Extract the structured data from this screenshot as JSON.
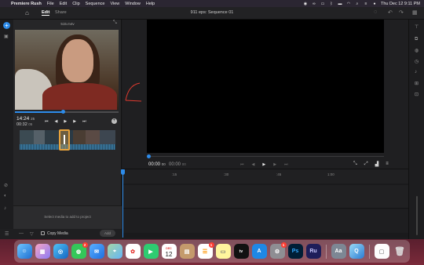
{
  "menubar": {
    "apple": "",
    "app_name": "Premiere Rush",
    "items": [
      "File",
      "Edit",
      "Clip",
      "Sequence",
      "View",
      "Window",
      "Help"
    ],
    "datetime": "Thu Dec 12  9:11 PM"
  },
  "titlebar": {
    "edit_tab": "Edit",
    "share_tab": "Share",
    "title": "911 eps: Sequence 01"
  },
  "source": {
    "clip_name": "515.m4v",
    "time": "14:24",
    "time_frames": "25",
    "duration": "00:32",
    "duration_frames": "05",
    "hint": "Select media to add to project",
    "copy_media_label": "Copy Media",
    "add_label": "Add"
  },
  "program": {
    "time": "00:00",
    "time_frames": "00",
    "duration": "00:00",
    "duration_frames": "00"
  },
  "timeline": {
    "ticks": [
      ":15",
      ":30",
      ":45",
      "1:00"
    ]
  },
  "dock": {
    "calendar_month": "DEC",
    "calendar_day": "12",
    "badge_messages": "2",
    "badge_reminders": "1",
    "badge_settings": "1",
    "ps_label": "Ps",
    "ru_label": "Ru",
    "tv_label": "tv"
  },
  "colors": {
    "accent": "#2d8ceb",
    "inout": "#e8a33c",
    "annotation": "#e03a2f"
  }
}
